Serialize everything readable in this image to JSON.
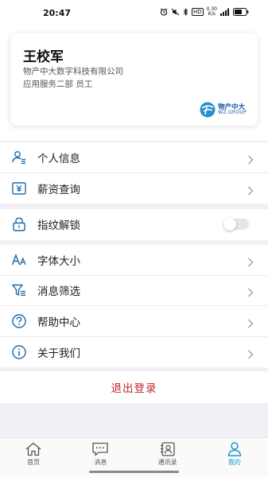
{
  "status_bar": {
    "time": "20:47",
    "icons": [
      "alarm-icon",
      "mute-icon",
      "bluetooth-icon",
      "hd-icon",
      "network-speed-icon",
      "signal-icon",
      "battery-icon"
    ],
    "hd_label": "HD",
    "net_speed": "0.30",
    "net_unit": "K/s"
  },
  "profile": {
    "name": "王校军",
    "company": "物产中大数字科技有限公司",
    "department": "应用服务二部  员工",
    "logo": {
      "cn": "物产中大",
      "en": "WZ.GROUP"
    }
  },
  "menu_groups": [
    [
      {
        "label": "个人信息",
        "icon": "person-list-icon",
        "action": "chevron"
      },
      {
        "label": "薪资查询",
        "icon": "salary-icon",
        "action": "chevron"
      }
    ],
    [
      {
        "label": "指纹解锁",
        "icon": "lock-icon",
        "action": "toggle",
        "toggle_on": false
      }
    ],
    [
      {
        "label": "字体大小",
        "icon": "font-size-icon",
        "action": "chevron"
      },
      {
        "label": "消息筛选",
        "icon": "filter-icon",
        "action": "chevron"
      },
      {
        "label": "帮助中心",
        "icon": "help-icon",
        "action": "chevron"
      },
      {
        "label": "关于我们",
        "icon": "info-icon",
        "action": "chevron"
      }
    ]
  ],
  "logout_label": "退出登录",
  "tabs": [
    {
      "label": "首页",
      "icon": "home-icon",
      "active": false
    },
    {
      "label": "消息",
      "icon": "message-icon",
      "active": false
    },
    {
      "label": "通讯录",
      "icon": "contacts-icon",
      "active": false
    },
    {
      "label": "我的",
      "icon": "profile-icon",
      "active": true
    }
  ],
  "colors": {
    "accent": "#2396c6",
    "icon_blue": "#1c6aa5",
    "logout_red": "#c4262b",
    "background": "#f1f0f7"
  }
}
